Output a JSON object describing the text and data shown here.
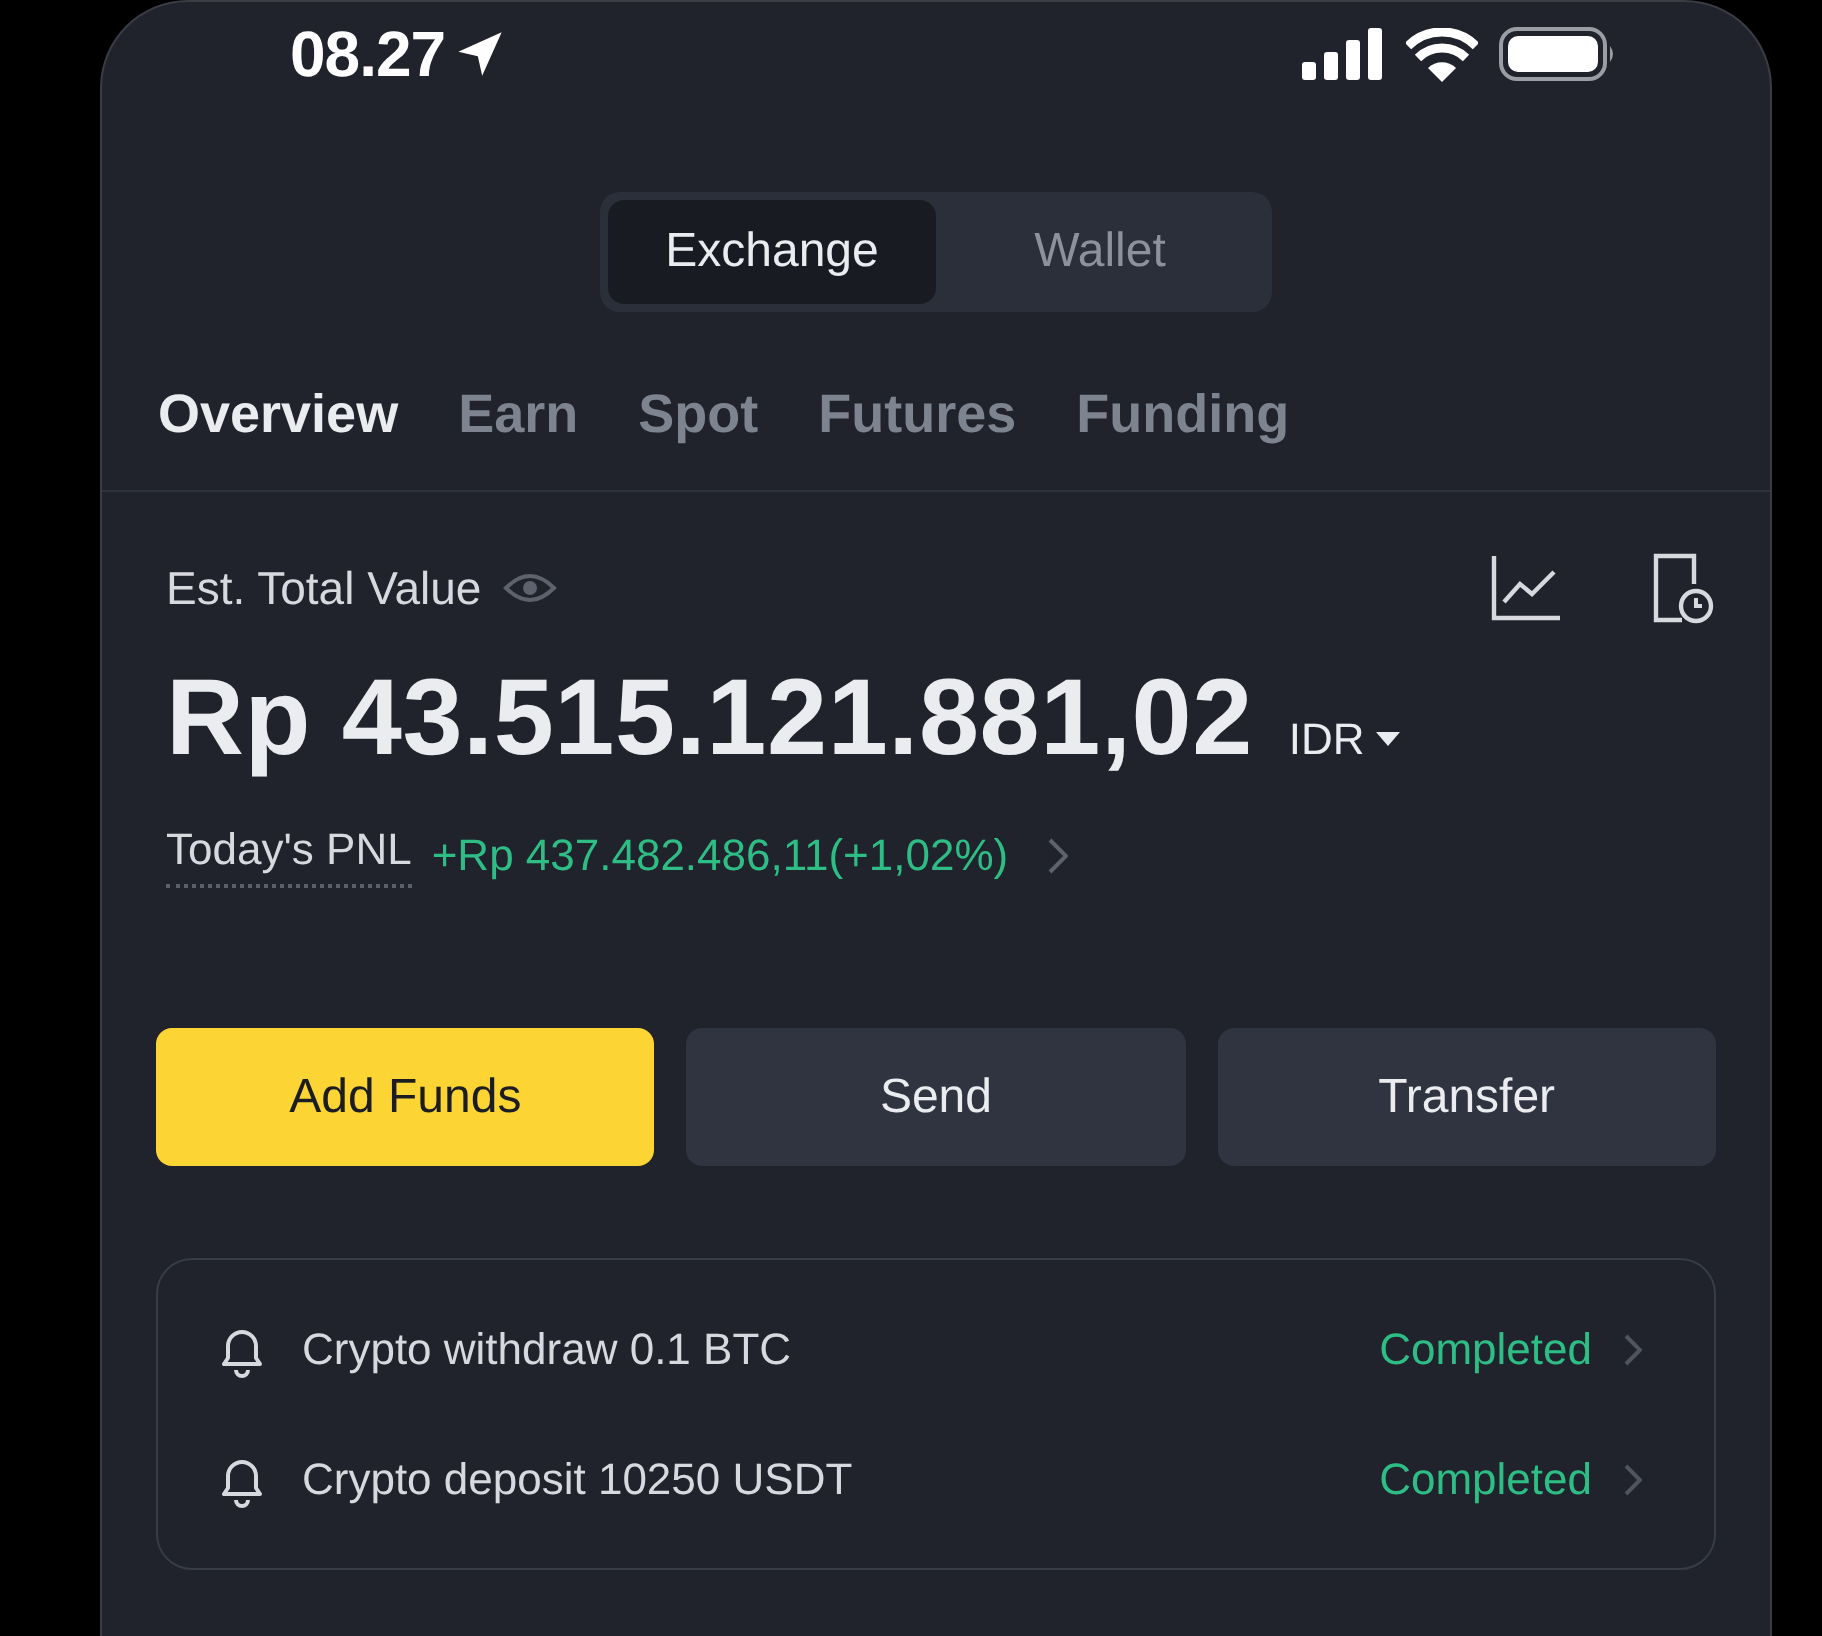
{
  "status_bar": {
    "time": "08.27"
  },
  "segments": [
    {
      "label": "Exchange",
      "selected": true
    },
    {
      "label": "Wallet",
      "selected": false
    }
  ],
  "tabs": [
    {
      "label": "Overview",
      "selected": true
    },
    {
      "label": "Earn",
      "selected": false
    },
    {
      "label": "Spot",
      "selected": false
    },
    {
      "label": "Futures",
      "selected": false
    },
    {
      "label": "Funding",
      "selected": false
    }
  ],
  "balance": {
    "label": "Est. Total Value",
    "value": "Rp 43.515.121.881,02",
    "currency": "IDR",
    "pnl_label": "Today's PNL",
    "pnl_value": "+Rp 437.482.486,11(+1,02%)"
  },
  "actions": [
    {
      "label": "Add Funds",
      "kind": "primary"
    },
    {
      "label": "Send",
      "kind": "secondary"
    },
    {
      "label": "Transfer",
      "kind": "secondary"
    }
  ],
  "notifications": [
    {
      "text": "Crypto withdraw 0.1 BTC",
      "status": "Completed"
    },
    {
      "text": "Crypto deposit 10250 USDT",
      "status": "Completed"
    }
  ]
}
